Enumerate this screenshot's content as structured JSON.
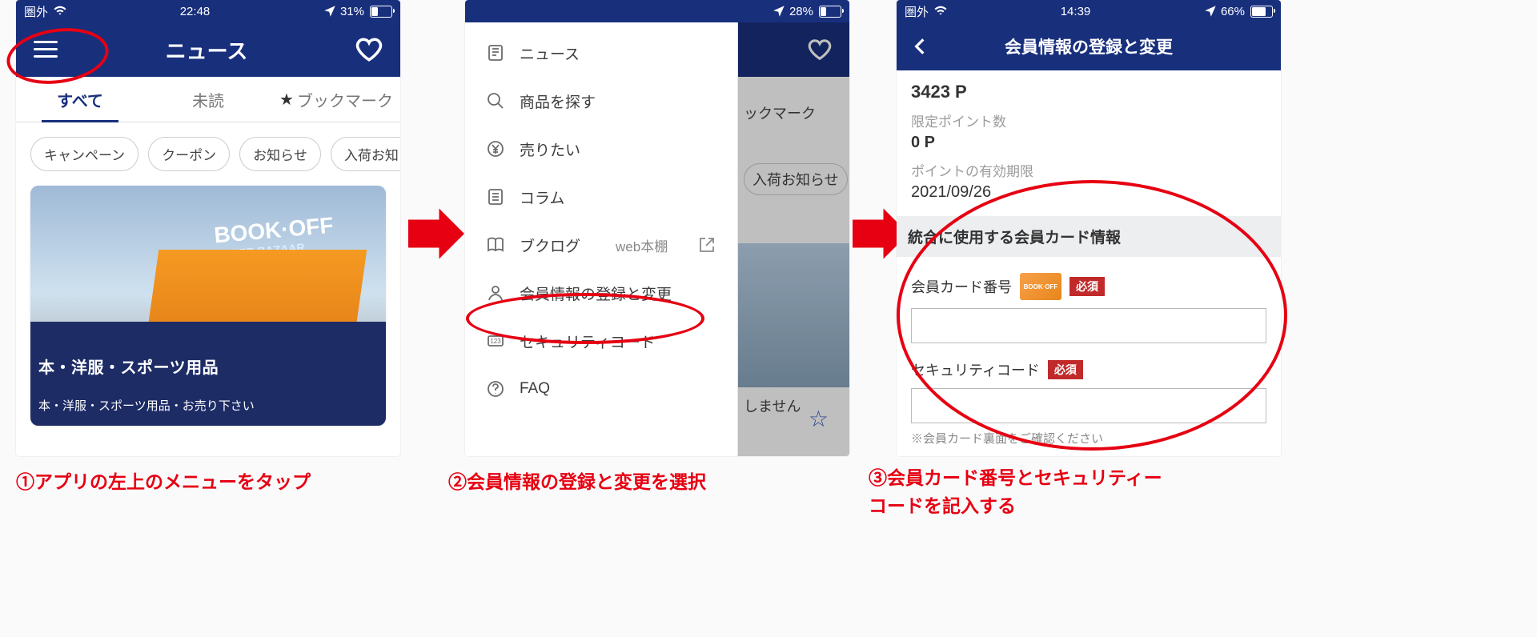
{
  "captions": {
    "c1": "①アプリの左上のメニューをタップ",
    "c2": "②会員情報の登録と変更を選択",
    "c3a": "③会員カード番号とセキュリティー",
    "c3b": "コードを記入する"
  },
  "screen1": {
    "status": {
      "left": "圏外",
      "time": "22:48",
      "battery": "31%"
    },
    "title": "ニュース",
    "tabs": {
      "all": "すべて",
      "unread": "未読",
      "bookmark": "ブックマーク"
    },
    "chips": [
      "キャンペーン",
      "クーポン",
      "お知らせ",
      "入荷お知らせ"
    ],
    "card": {
      "logo1": "BOOK·OFF",
      "logo2": "SUPER BAZAAR",
      "banner": "本・洋服・スポーツ用品",
      "banner2": "本・洋服・スポーツ用品・お売り下さい"
    }
  },
  "screen2": {
    "status": {
      "battery": "28%"
    },
    "menu": {
      "news": "ニュース",
      "search": "商品を探す",
      "sell": "売りたい",
      "column": "コラム",
      "log": "ブクログ",
      "logSub": "web本棚",
      "member": "会員情報の登録と変更",
      "code": "セキュリティコード",
      "faq": "FAQ"
    },
    "peek": {
      "bookmark": "ックマーク",
      "stock": "入荷お知らせ",
      "none": "しません"
    }
  },
  "screen3": {
    "status": {
      "left": "圏外",
      "time": "14:39",
      "battery": "66%"
    },
    "title": "会員情報の登録と変更",
    "points": "3423 P",
    "limitedLabel": "限定ポイント数",
    "limited": "0 P",
    "expireLabel": "ポイントの有効期限",
    "expire": "2021/09/26",
    "subheader": "統合に使用する会員カード情報",
    "cardNoLabel": "会員カード番号",
    "cardLogo": "BOOK·OFF",
    "secLabel": "セキュリティコード",
    "required": "必須",
    "hint": "※会員カード裏面をご確認ください"
  }
}
